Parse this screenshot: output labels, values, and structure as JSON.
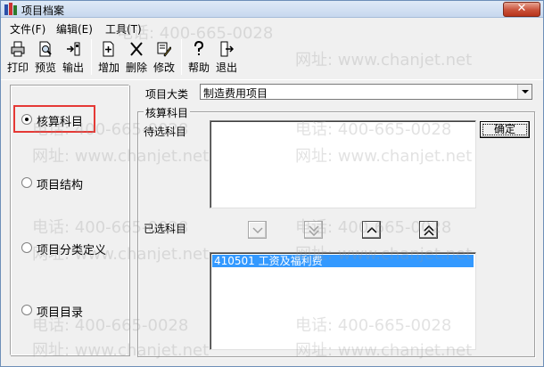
{
  "window": {
    "title": "项目档案",
    "close_glyph": "✕"
  },
  "menu": {
    "items": [
      {
        "label": "文件(F)"
      },
      {
        "label": "编辑(E)"
      },
      {
        "label": "工具(T)"
      }
    ]
  },
  "toolbar": {
    "print": "打印",
    "preview": "预览",
    "export": "输出",
    "add": "增加",
    "delete": "删除",
    "modify": "修改",
    "help": "帮助",
    "exit": "退出"
  },
  "left_panel": {
    "options": [
      {
        "label": "核算科目",
        "checked": true
      },
      {
        "label": "项目结构",
        "checked": false
      },
      {
        "label": "项目分类定义",
        "checked": false
      },
      {
        "label": "项目目录",
        "checked": false
      }
    ]
  },
  "category": {
    "label": "项目大类",
    "value": "制造费用项目"
  },
  "accounts": {
    "group_title": "核算科目",
    "pending_label": "待选科目",
    "selected_label": "已选科目",
    "confirm_button": "确定",
    "selected_items": [
      {
        "text": "410501  工资及福利费"
      }
    ]
  },
  "watermark": {
    "phone": "电话: 400-665-0028",
    "site": "网址: www.chanjet.net"
  },
  "colors": {
    "selection": "#3399ff",
    "highlight_border": "#e53935",
    "close_button": "#c9513a"
  }
}
